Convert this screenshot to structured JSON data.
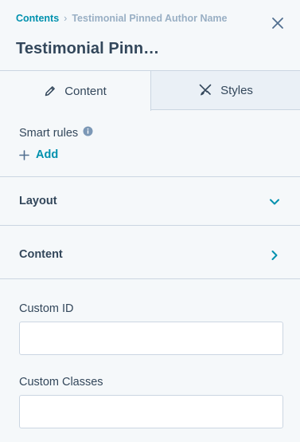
{
  "header": {
    "breadcrumb": {
      "link": "Contents",
      "separator": "›",
      "current": "Testimonial Pinned Author Name"
    },
    "title": "Testimonial Pinn…",
    "close_icon": "close-icon"
  },
  "tabs": [
    {
      "label": "Content",
      "icon": "pencil-icon",
      "active": true
    },
    {
      "label": "Styles",
      "icon": "brush-icon",
      "active": false
    }
  ],
  "smart_rules": {
    "label": "Smart rules",
    "info_icon": "info-icon",
    "add_label": "Add"
  },
  "sections": [
    {
      "label": "Layout",
      "state": "expanded",
      "icon": "chevron-down-icon"
    },
    {
      "label": "Content",
      "state": "collapsed",
      "icon": "chevron-right-icon"
    }
  ],
  "fields": [
    {
      "label": "Custom ID",
      "value": ""
    },
    {
      "label": "Custom Classes",
      "value": ""
    }
  ],
  "colors": {
    "accent": "#0091ae",
    "text": "#33475b",
    "muted": "#99afc4",
    "border": "#cbd6e2",
    "background": "#f5f8fa",
    "inactive_tab": "#eaf0f6"
  }
}
